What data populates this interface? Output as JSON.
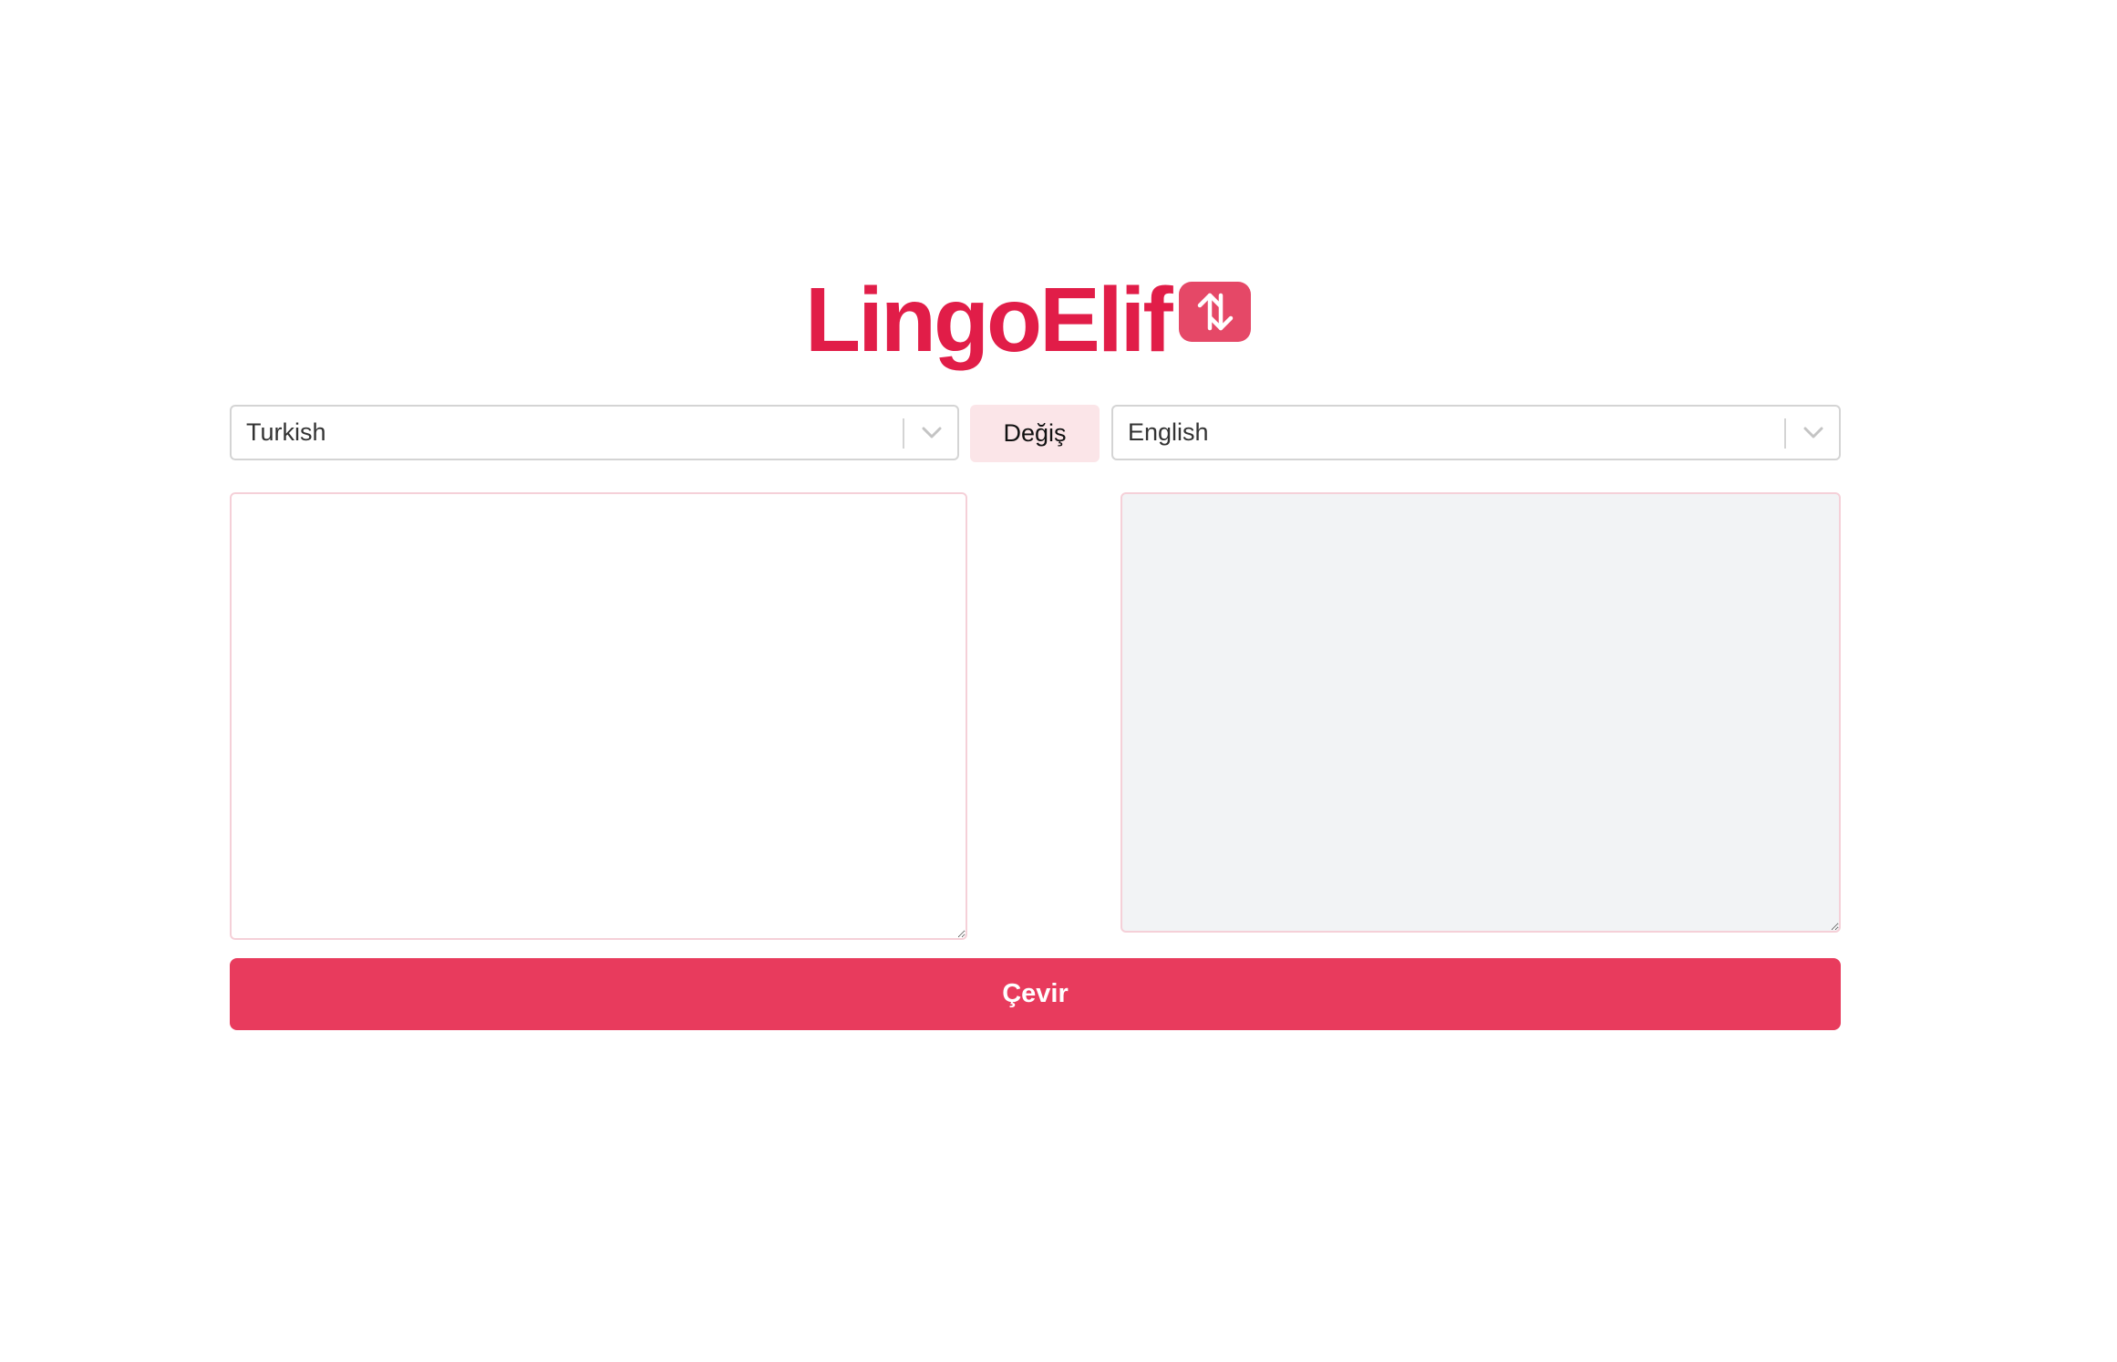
{
  "app": {
    "title": "LingoElif",
    "logo_icon": "swap-vertical-icon"
  },
  "languages": {
    "source": {
      "selected": "Turkish",
      "icon": "chevron-down-icon"
    },
    "target": {
      "selected": "English",
      "icon": "chevron-down-icon"
    },
    "swap_label": "Değiş"
  },
  "editor": {
    "source_text": "",
    "target_text": ""
  },
  "actions": {
    "translate_label": "Çevir"
  },
  "colors": {
    "brand": "#e11d48",
    "button": "#e83b5d",
    "swap_bg": "#fbe5e8",
    "output_bg": "#f2f3f5"
  }
}
